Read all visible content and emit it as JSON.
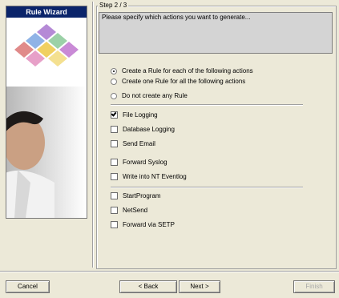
{
  "sidebar": {
    "title": "Rule Wizard"
  },
  "step": {
    "label": "Step 2 / 3",
    "description": "Please specify which actions you want to generate..."
  },
  "options": {
    "radios": [
      {
        "label": "Create a Rule for each of the following actions",
        "selected": true
      },
      {
        "label": "Create one Rule for all the following actions",
        "selected": false
      },
      {
        "label": "Do not create any Rule",
        "selected": false
      }
    ],
    "checkboxes": [
      {
        "label": "File Logging",
        "checked": true
      },
      {
        "label": "Database Logging",
        "checked": false
      },
      {
        "label": "Send Email",
        "checked": false
      },
      {
        "label": "Forward Syslog",
        "checked": false
      },
      {
        "label": "Write into NT Eventlog",
        "checked": false
      },
      {
        "label": "StartProgram",
        "checked": false
      },
      {
        "label": "NetSend",
        "checked": false
      },
      {
        "label": "Forward via SETP",
        "checked": false
      }
    ]
  },
  "buttons": {
    "cancel": "Cancel",
    "back": "< Back",
    "next": "Next >",
    "finish": "Finish"
  }
}
